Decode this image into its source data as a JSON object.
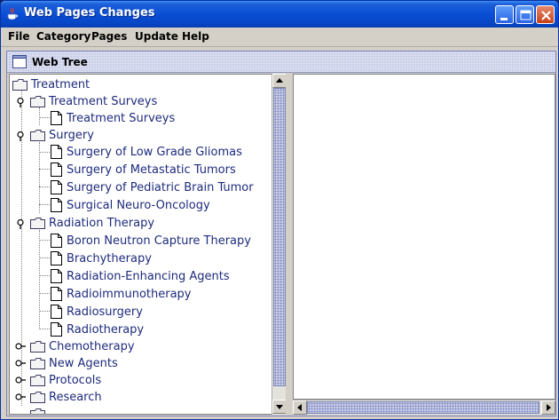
{
  "window": {
    "title": "Web Pages Changes",
    "icon": "java-cup-icon",
    "controls": [
      "minimize",
      "maximize",
      "close"
    ]
  },
  "menubar": {
    "items": [
      "File",
      "Category",
      "Pages",
      "Update",
      "Help"
    ]
  },
  "panel": {
    "title": "Web Tree"
  },
  "tree": {
    "root": "Treatment",
    "nodes": [
      {
        "label": "Treatment Surveys",
        "type": "folder",
        "expanded": true
      },
      {
        "label": "Treatment Surveys",
        "type": "page"
      },
      {
        "label": "Surgery",
        "type": "folder",
        "expanded": true
      },
      {
        "label": "Surgery of Low Grade Gliomas",
        "type": "page"
      },
      {
        "label": "Surgery of Metastatic Tumors",
        "type": "page"
      },
      {
        "label": "Surgery of Pediatric Brain Tumor",
        "type": "page"
      },
      {
        "label": "Surgical Neuro-Oncology",
        "type": "page"
      },
      {
        "label": "Radiation Therapy",
        "type": "folder",
        "expanded": true
      },
      {
        "label": "Boron Neutron Capture Therapy",
        "type": "page"
      },
      {
        "label": "Brachytherapy",
        "type": "page"
      },
      {
        "label": "Radiation-Enhancing Agents",
        "type": "page"
      },
      {
        "label": "Radioimmunotherapy",
        "type": "page"
      },
      {
        "label": "Radiosurgery",
        "type": "page"
      },
      {
        "label": "Radiotherapy",
        "type": "page"
      },
      {
        "label": "Chemotherapy",
        "type": "folder",
        "expanded": false
      },
      {
        "label": "New Agents",
        "type": "folder",
        "expanded": false
      },
      {
        "label": "Protocols",
        "type": "folder",
        "expanded": false
      },
      {
        "label": "Research",
        "type": "folder",
        "expanded": false
      }
    ]
  },
  "colors": {
    "titlebar": "#0a4ed6",
    "tree_text": "#1e2b7c",
    "panel_header": "#c6cbe6"
  }
}
